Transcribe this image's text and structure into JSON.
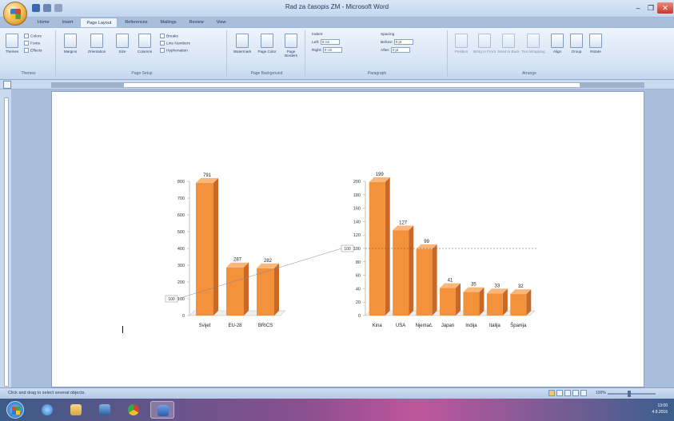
{
  "window": {
    "title": "Rad za časopis ZM - Microsoft Word",
    "minimize_glyph": "–",
    "maximize_glyph": "❐",
    "close_glyph": "✕"
  },
  "tabs": [
    "Home",
    "Insert",
    "Page Layout",
    "References",
    "Mailings",
    "Review",
    "View"
  ],
  "active_tab": "Page Layout",
  "ribbon": {
    "themes": {
      "label": "Themes",
      "colors": "Colors",
      "fonts": "Fonts",
      "effects": "Effects",
      "group": "Themes"
    },
    "page_setup": {
      "margins": "Margins",
      "orientation": "Orientation",
      "size": "Size",
      "columns": "Columns",
      "breaks": "Breaks",
      "line_numbers": "Line Numbers",
      "hyphenation": "Hyphenation",
      "group": "Page Setup"
    },
    "page_background": {
      "watermark": "Watermark",
      "page_color": "Page Color",
      "page_borders": "Page Borders",
      "group": "Page Background"
    },
    "paragraph": {
      "indent": "Indent",
      "left_label": "Left:",
      "left_value": "0 cm",
      "right_label": "Right:",
      "right_value": "0 cm",
      "spacing": "Spacing",
      "before_label": "Before:",
      "before_value": "0 pt",
      "after_label": "After:",
      "after_value": "0 pt",
      "group": "Paragraph"
    },
    "arrange": {
      "position": "Position",
      "bring_to_front": "Bring to Front",
      "send_to_back": "Send to Back",
      "text_wrapping": "Text Wrapping",
      "align": "Align",
      "group_btn": "Group",
      "rotate": "Rotate",
      "group": "Arrange"
    }
  },
  "statusbar": {
    "text": "Click and drag to select several objects.",
    "zoom": "100%"
  },
  "taskbar": {
    "time": "13:00",
    "date": "4.8.2016"
  },
  "colors": {
    "bar_front": "#f4923b",
    "bar_side": "#c8692a",
    "bar_top": "#fbb77a",
    "accent": "#2b579a"
  },
  "chart_data": [
    {
      "type": "bar",
      "categories": [
        "Svijet",
        "EU-28",
        "BRICS"
      ],
      "values": [
        791,
        287,
        282
      ],
      "ylim": [
        0,
        800
      ],
      "yticks": [
        0,
        100,
        200,
        300,
        400,
        500,
        600,
        700,
        800
      ],
      "ytick_labels": [
        "0",
        "100",
        "200",
        "300",
        "400",
        "500",
        "600",
        "700",
        "800"
      ],
      "reference_label": "100",
      "grid": false
    },
    {
      "type": "bar",
      "categories": [
        "Kina",
        "USA",
        "Njemač.",
        "Japan",
        "Indija",
        "Italija",
        "Španija"
      ],
      "values": [
        199,
        127,
        99,
        41,
        35,
        33,
        32
      ],
      "ylim": [
        0,
        200
      ],
      "yticks": [
        0,
        20,
        40,
        60,
        80,
        100,
        120,
        140,
        160,
        180,
        200
      ],
      "ytick_labels": [
        "0",
        "20",
        "40",
        "60",
        "80",
        "100",
        "120",
        "140",
        "160",
        "180",
        "200"
      ],
      "reference_line": 100,
      "reference_label": "100",
      "grid": false
    }
  ]
}
